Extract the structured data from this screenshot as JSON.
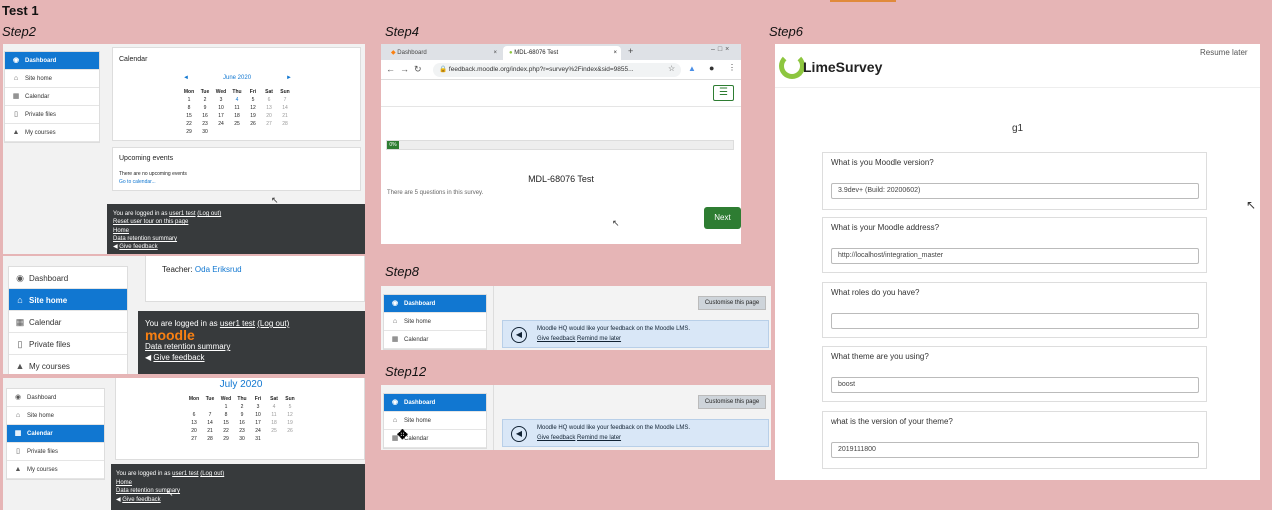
{
  "page": {
    "title": "Test 1"
  },
  "step_labels": {
    "step2": "Step2",
    "step4": "Step4",
    "step6": "Step6",
    "step8": "Step8",
    "step12": "Step12"
  },
  "step2": {
    "sidebar": [
      "Dashboard",
      "Site home",
      "Calendar",
      "Private files",
      "My courses"
    ],
    "calendar": {
      "heading": "Calendar",
      "month": "June 2020",
      "days": [
        "Mon",
        "Tue",
        "Wed",
        "Thu",
        "Fri",
        "Sat",
        "Sun"
      ],
      "weeks": [
        [
          "1",
          "2",
          "3",
          "4",
          "5",
          "6",
          "7"
        ],
        [
          "8",
          "9",
          "10",
          "11",
          "12",
          "13",
          "14"
        ],
        [
          "15",
          "16",
          "17",
          "18",
          "19",
          "20",
          "21"
        ],
        [
          "22",
          "23",
          "24",
          "25",
          "26",
          "27",
          "28"
        ],
        [
          "29",
          "30",
          "",
          "",
          "",
          "",
          ""
        ]
      ]
    },
    "upcoming": {
      "heading": "Upcoming events",
      "none": "There are no upcoming events",
      "link": "Go to calendar..."
    },
    "footer": {
      "logged_prefix": "You are logged in as",
      "user": "user1 test",
      "logout": "(Log out)",
      "reset": "Reset user tour on this page",
      "home": "Home",
      "retention": "Data retention summary",
      "feedback": "Give feedback"
    }
  },
  "panel_b": {
    "sidebar": [
      "Dashboard",
      "Site home",
      "Calendar",
      "Private files",
      "My courses"
    ],
    "teacher_label": "Teacher:",
    "teacher_name": "Oda Eriksrud",
    "footer": {
      "logged_prefix": "You are logged in as",
      "user": "user1 test",
      "logout": "(Log out)",
      "logo": "moodle",
      "retention": "Data retention summary",
      "feedback": "Give feedback"
    }
  },
  "panel_c": {
    "sidebar": [
      "Dashboard",
      "Site home",
      "Calendar",
      "Private files",
      "My courses"
    ],
    "month": "July 2020",
    "days": [
      "Mon",
      "Tue",
      "Wed",
      "Thu",
      "Fri",
      "Sat",
      "Sun"
    ],
    "weeks": [
      [
        "",
        "",
        "1",
        "2",
        "3",
        "4",
        "5"
      ],
      [
        "6",
        "7",
        "8",
        "9",
        "10",
        "11",
        "12"
      ],
      [
        "13",
        "14",
        "15",
        "16",
        "17",
        "18",
        "19"
      ],
      [
        "20",
        "21",
        "22",
        "23",
        "24",
        "25",
        "26"
      ],
      [
        "27",
        "28",
        "29",
        "30",
        "31",
        "",
        ""
      ]
    ],
    "footer": {
      "logged_prefix": "You are logged in as",
      "user": "user1 test",
      "logout": "(Log out)",
      "home": "Home",
      "retention": "Data retention summary",
      "feedback": "Give feedback"
    }
  },
  "step4": {
    "tabs": [
      "Dashboard",
      "MDL-68076 Test"
    ],
    "url": "feedback.moodle.org/index.php?r=survey%2Findex&sid=9855...",
    "progress": "0%",
    "survey_title": "MDL-68076 Test",
    "survey_desc": "There are 5 questions in this survey.",
    "next": "Next"
  },
  "step6": {
    "resume": "Resume later",
    "brand": "LimeSurvey",
    "group": "g1",
    "questions": [
      {
        "q": "What is you Moodle version?",
        "a": "3.9dev+ (Build: 20200602)"
      },
      {
        "q": "What is your Moodle address?",
        "a": "http://localhost/integration_master"
      },
      {
        "q": "What roles do you have?",
        "a": ""
      },
      {
        "q": "What theme are you using?",
        "a": "boost"
      },
      {
        "q": "what is the version of your theme?",
        "a": "2019111800"
      }
    ]
  },
  "step8": {
    "sidebar": [
      "Dashboard",
      "Site home",
      "Calendar"
    ],
    "customise": "Customise this page",
    "notice": "Moodle HQ would like your feedback on the Moodle LMS.",
    "give_feedback": "Give feedback",
    "remind": "Remind me later"
  },
  "step12": {
    "sidebar": [
      "Dashboard",
      "Site home",
      "Calendar"
    ],
    "customise": "Customise this page",
    "notice": "Moodle HQ would like your feedback on the Moodle LMS.",
    "give_feedback": "Give feedback",
    "remind": "Remind me later"
  },
  "colors": {
    "moodle_blue": "#1177d1",
    "moodle_orange": "#f98012",
    "next_green": "#2e7d32",
    "lime_green": "#8dc63f",
    "background": "#e6b5b6"
  }
}
